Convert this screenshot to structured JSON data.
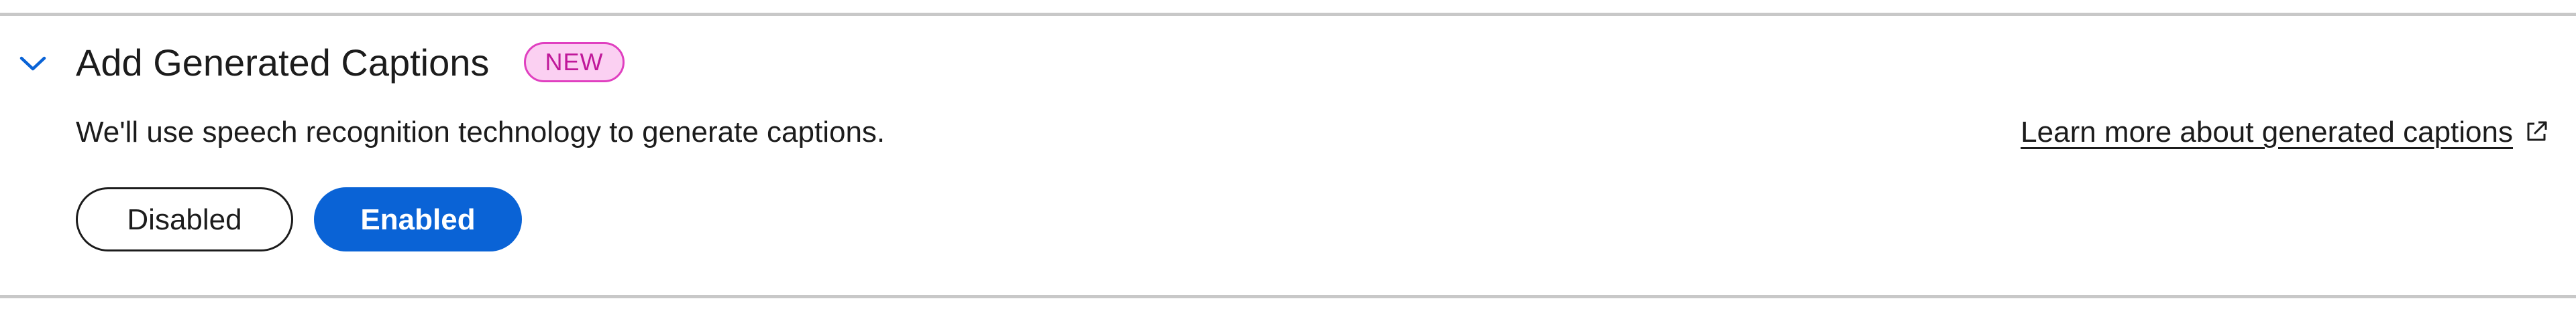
{
  "section": {
    "title": "Add Generated Captions",
    "badge": "NEW",
    "description": "We'll use speech recognition technology to generate captions.",
    "learn_more_link": "Learn more about generated captions"
  },
  "toggle": {
    "disabled_label": "Disabled",
    "enabled_label": "Enabled",
    "selected": "Enabled"
  },
  "icons": {
    "collapse": "chevron-down-icon",
    "external": "external-link-icon"
  },
  "colors": {
    "accent": "#0a63d6",
    "badge_border": "#e040c0",
    "badge_fill": "#fbd0f2",
    "badge_text": "#c0189a",
    "divider": "#c8c8c8"
  }
}
